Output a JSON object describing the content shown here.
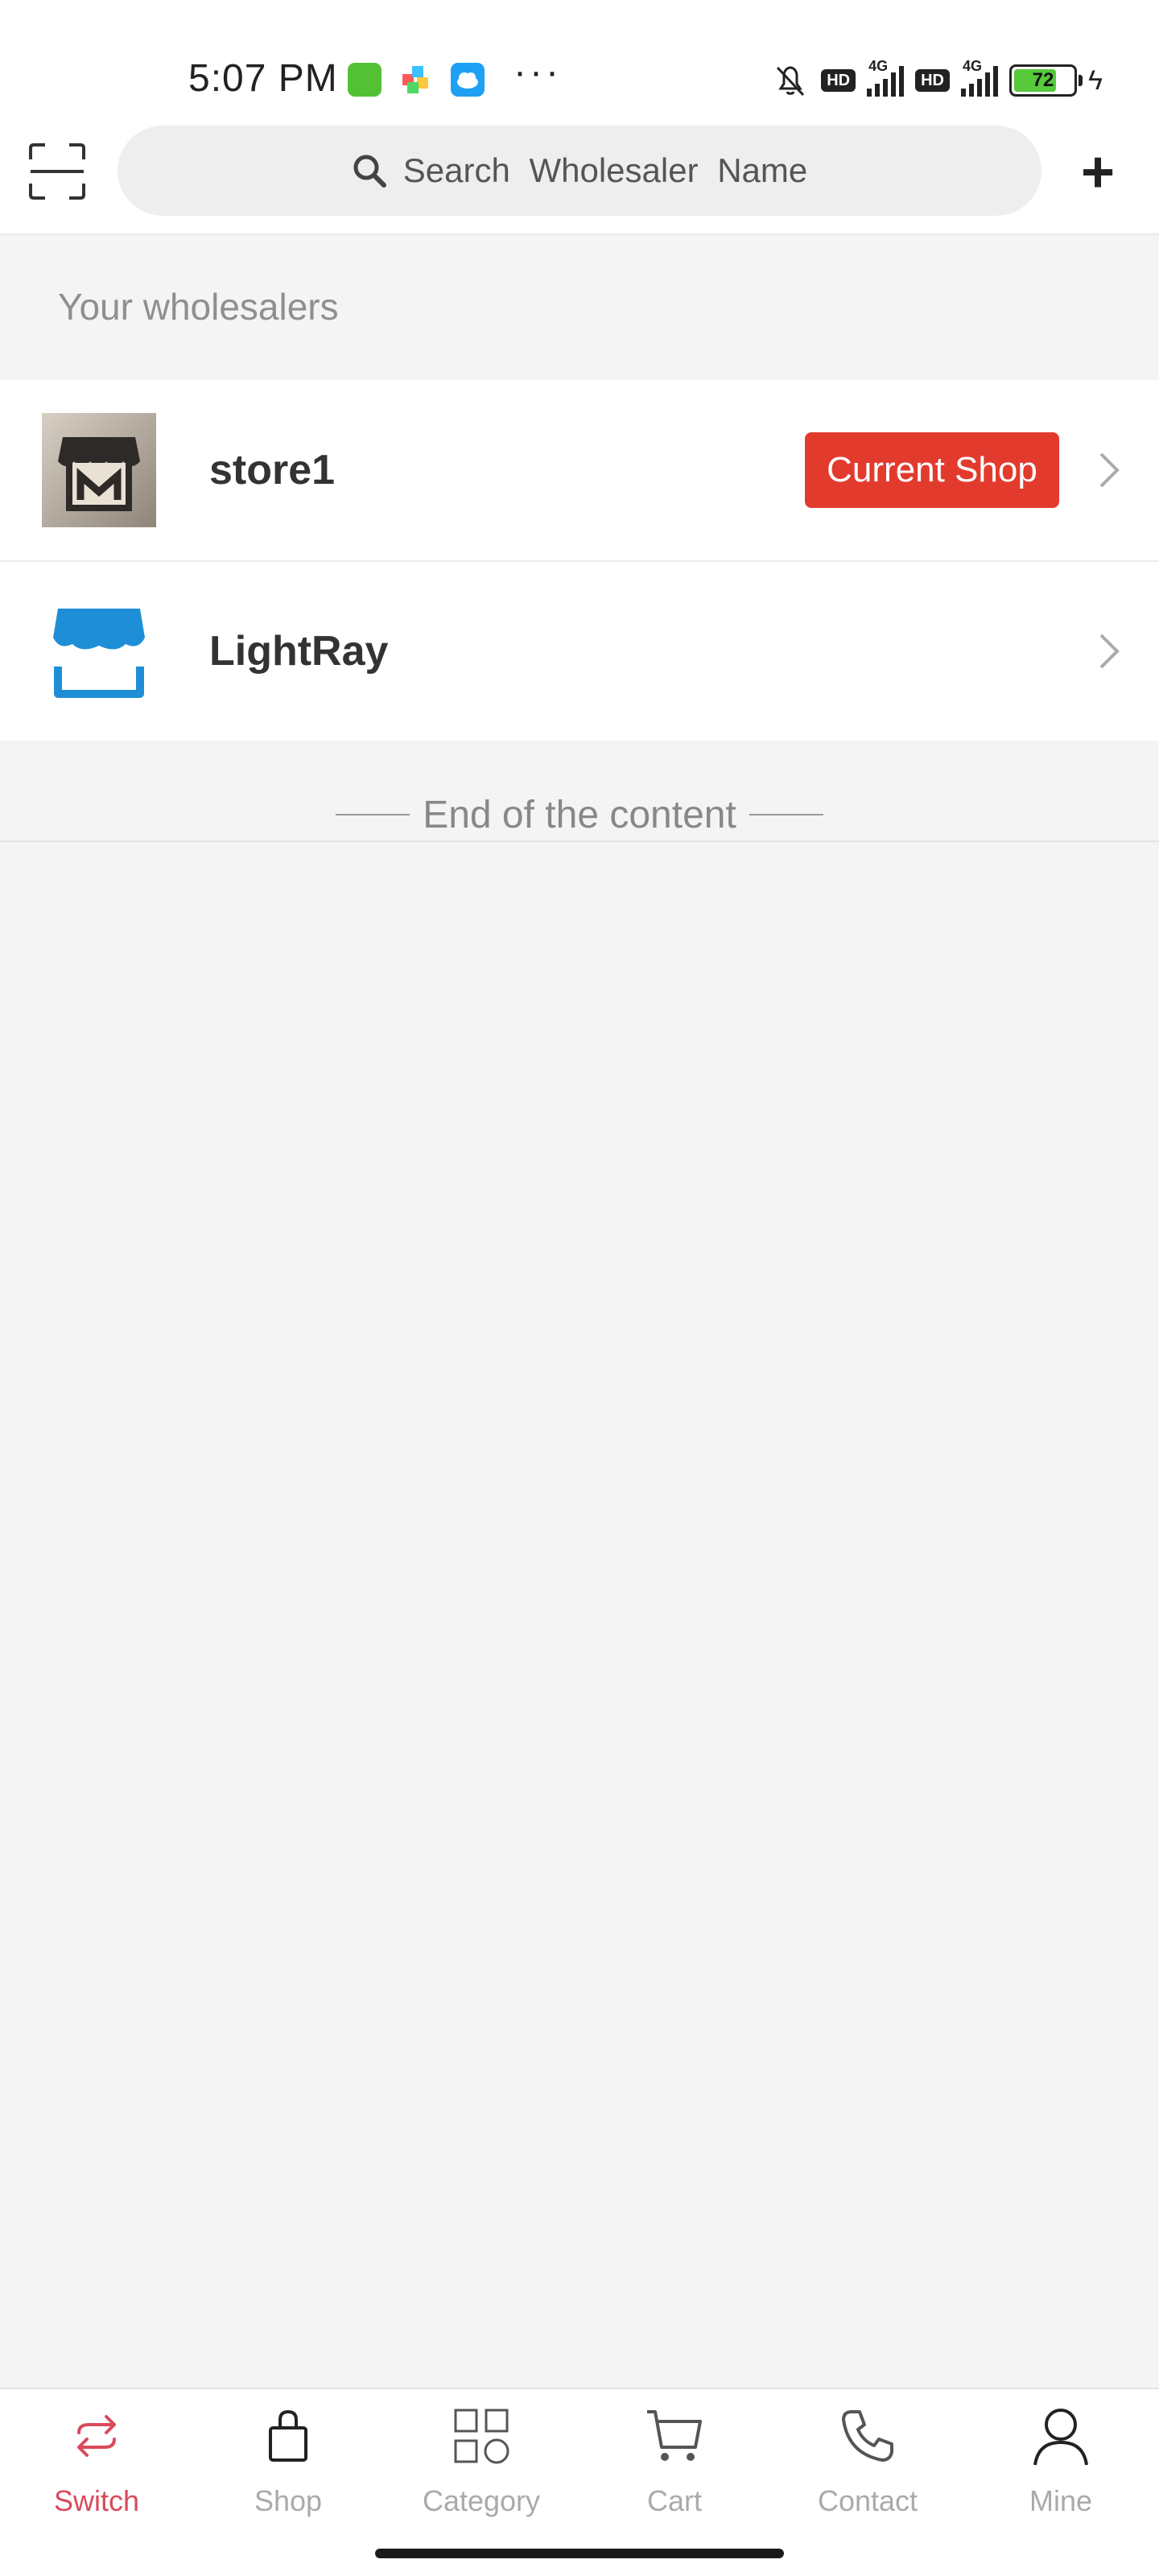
{
  "status_bar": {
    "time": "5:07 PM",
    "hd_label": "HD",
    "network": "4G",
    "battery": "72"
  },
  "header": {
    "search_placeholder": "Search  Wholesaler  Name",
    "scan_icon": "scan-icon",
    "add_icon": "plus-icon"
  },
  "section": {
    "title": "Your wholesalers"
  },
  "wholesalers": [
    {
      "name": "store1",
      "badge": "Current Shop",
      "icon": "store-logo-icon"
    },
    {
      "name": "LightRay",
      "icon": "shop-awning-icon"
    }
  ],
  "end_text": "End of the content",
  "tabs": [
    {
      "label": "Switch",
      "icon": "switch-icon",
      "active": true
    },
    {
      "label": "Shop",
      "icon": "bag-icon"
    },
    {
      "label": "Category",
      "icon": "grid-icon"
    },
    {
      "label": "Cart",
      "icon": "cart-icon"
    },
    {
      "label": "Contact",
      "icon": "phone-icon"
    },
    {
      "label": "Mine",
      "icon": "user-icon"
    }
  ],
  "colors": {
    "accent": "#e23b2e",
    "tab_active": "#d94a5b",
    "brand_blue": "#1e8fd6"
  }
}
